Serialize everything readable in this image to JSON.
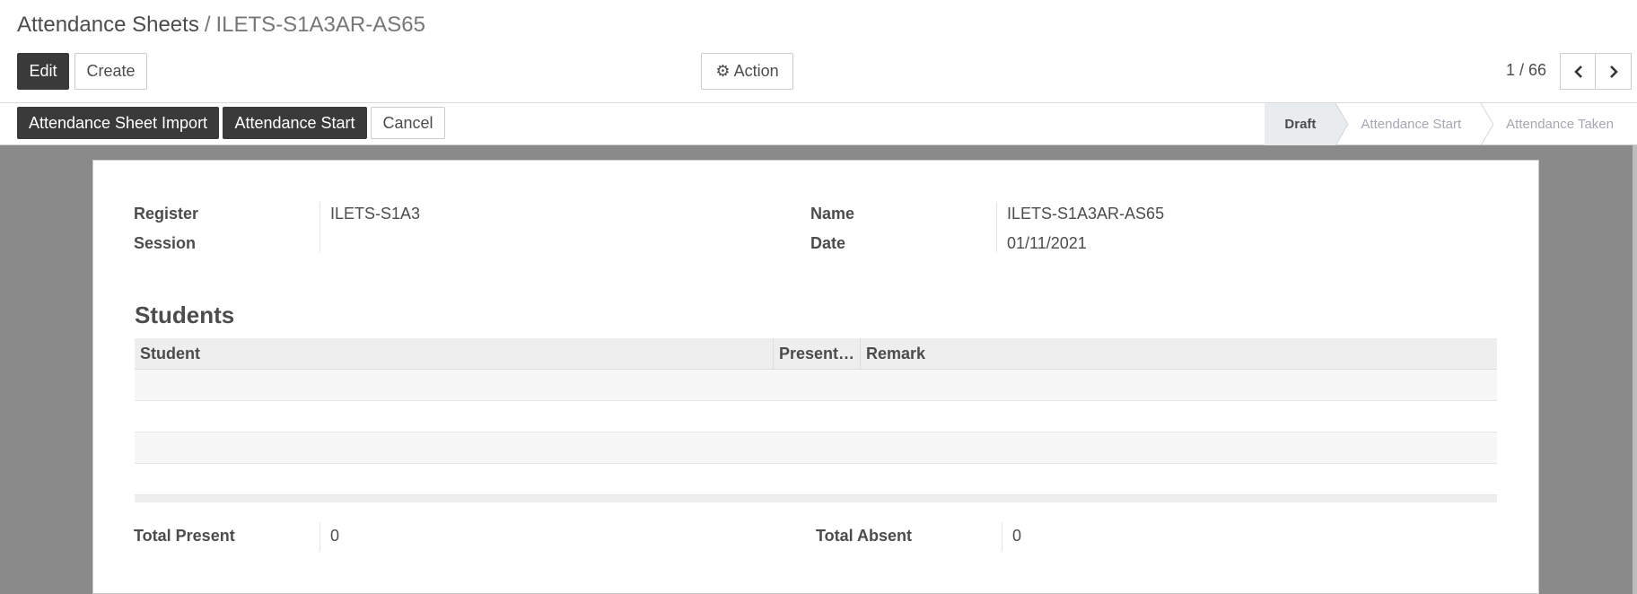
{
  "breadcrumb": {
    "parent": "Attendance Sheets",
    "separator": "/",
    "current": "ILETS-S1A3AR-AS65"
  },
  "buttons": {
    "edit": "Edit",
    "create": "Create",
    "action": "Action"
  },
  "pager": {
    "value": "1 / 66"
  },
  "statusbar": {
    "import": "Attendance Sheet Import",
    "start": "Attendance Start",
    "cancel": "Cancel",
    "stages": [
      "Draft",
      "Attendance Start",
      "Attendance Taken"
    ],
    "active_stage": "Draft"
  },
  "form": {
    "register_label": "Register",
    "register_value": "ILETS-S1A3",
    "session_label": "Session",
    "session_value": "",
    "name_label": "Name",
    "name_value": "ILETS-S1A3AR-AS65",
    "date_label": "Date",
    "date_value": "01/11/2021",
    "students_title": "Students",
    "columns": [
      "Student",
      "Present…",
      "Remark"
    ],
    "total_present_label": "Total Present",
    "total_present_value": "0",
    "total_absent_label": "Total Absent",
    "total_absent_value": "0"
  },
  "colors": {
    "primary_dark": "#3a3a3a",
    "background_gray": "#8a8a8a"
  }
}
